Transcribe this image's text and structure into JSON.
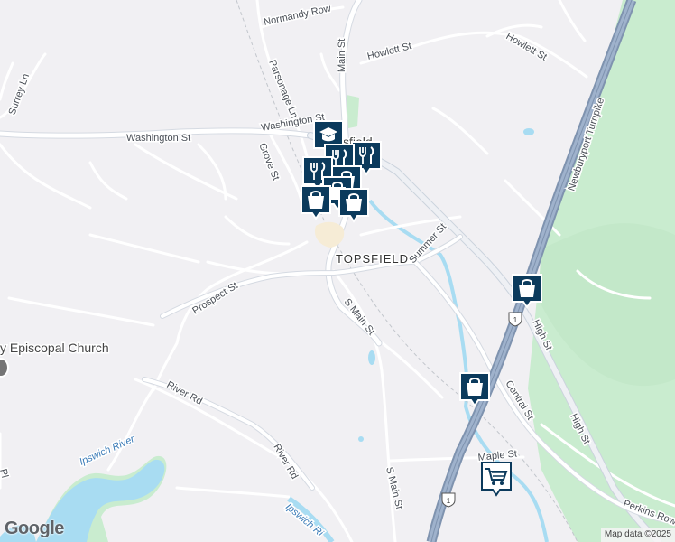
{
  "map": {
    "town_label": "TOPSFIELD",
    "center_label_partial": "sfield",
    "roads": [
      "Normandy Row",
      "Main St",
      "Howlett St",
      "Howlett St",
      "Surrey Ln",
      "Parsonage Ln",
      "Washington St",
      "Washington St",
      "Grove St",
      "Newburyport Turnpike",
      "Summer St",
      "Prospect St",
      "S Main St",
      "High St",
      "River Rd",
      "River Rd",
      "Central St",
      "High St",
      "Maple St",
      "S Main St",
      "Perkins Row",
      "Ipswich Ri",
      "Ipswich River",
      "Pl"
    ],
    "poi": "y Episcopal Church",
    "route_shields": [
      "1",
      "1"
    ],
    "markers": [
      {
        "type": "education",
        "icon": "school-icon"
      },
      {
        "type": "restaurant",
        "icon": "restaurant-icon"
      },
      {
        "type": "restaurant",
        "icon": "restaurant-icon"
      },
      {
        "type": "restaurant",
        "icon": "restaurant-icon"
      },
      {
        "type": "store",
        "icon": "shopping-bag-icon"
      },
      {
        "type": "store",
        "icon": "shopping-bag-icon"
      },
      {
        "type": "store",
        "icon": "shopping-bag-icon"
      },
      {
        "type": "store",
        "icon": "shopping-bag-icon"
      },
      {
        "type": "store",
        "icon": "shopping-bag-icon"
      },
      {
        "type": "supermarket",
        "icon": "shopping-cart-icon"
      }
    ],
    "colors": {
      "land": "#f1f0f3",
      "park": "#c9eccf",
      "water": "#a8dcf2",
      "road": "#ffffff",
      "road_casing": "#cfd6de",
      "highway": "#8ea2bd",
      "marker": "#0b3a5c"
    }
  },
  "footer": {
    "logo": "Google",
    "attribution": "Map data ©2025"
  }
}
